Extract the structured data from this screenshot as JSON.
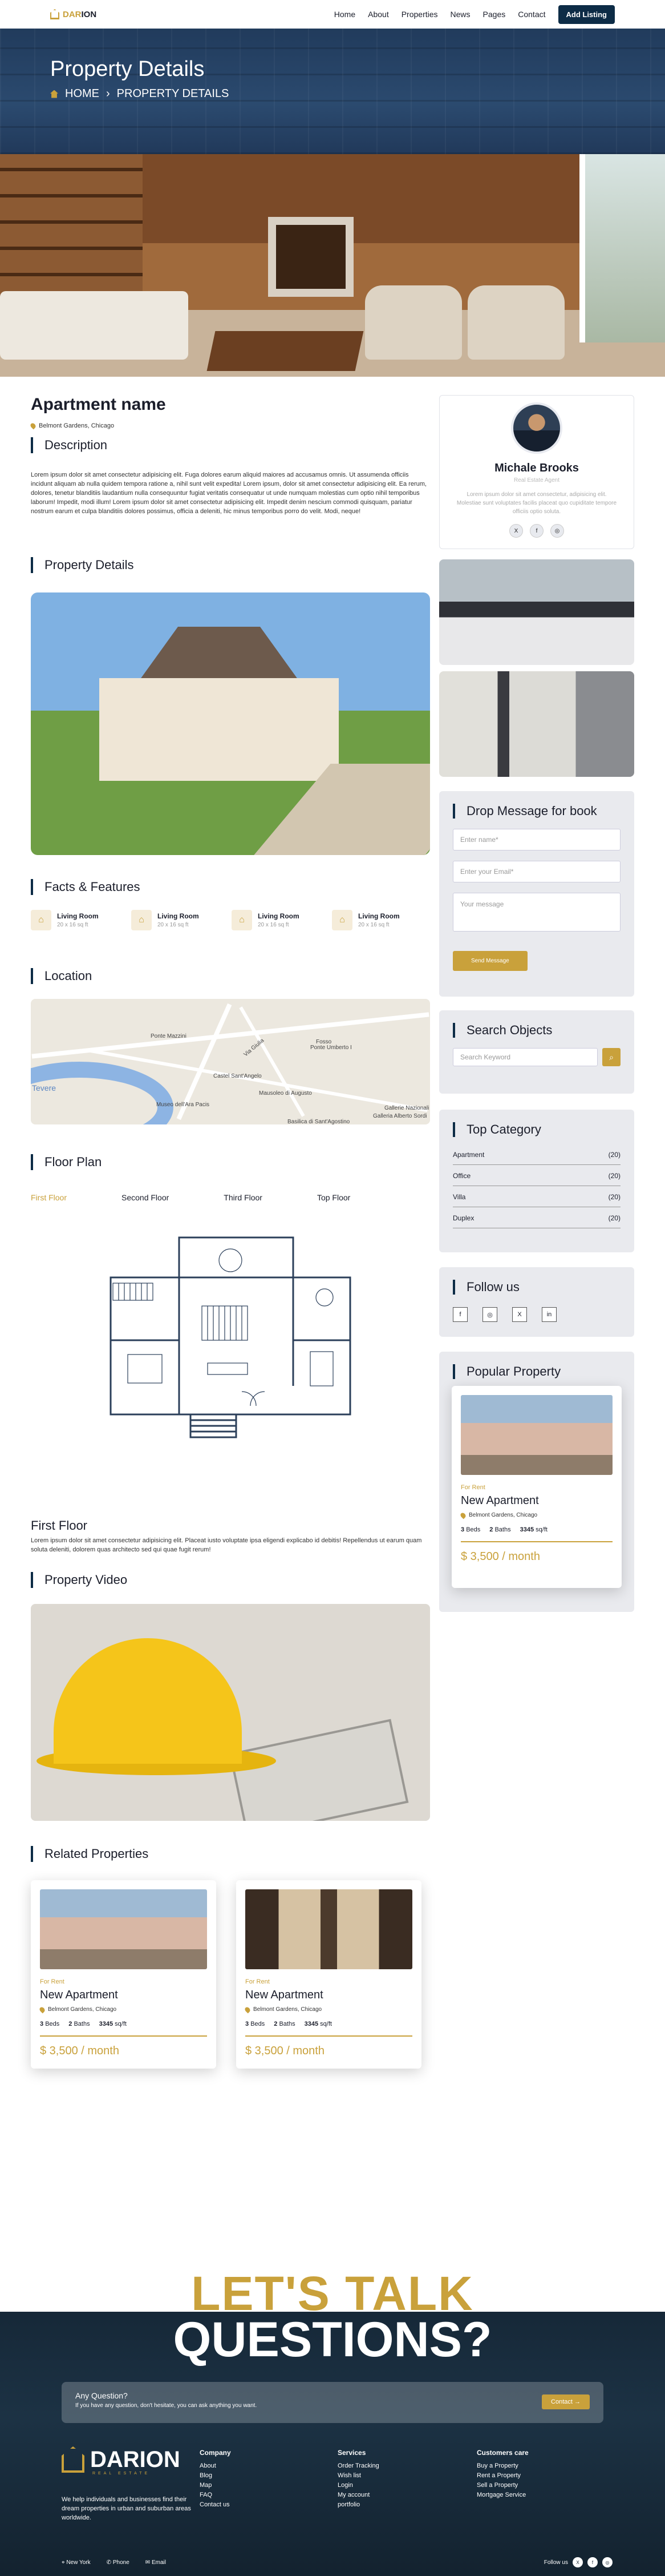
{
  "nav": {
    "brand_a": "DAR",
    "brand_b": "ION",
    "items": [
      "Home",
      "About",
      "Properties",
      "News",
      "Pages",
      "Contact"
    ],
    "cta": "Add Listing"
  },
  "hero": {
    "title": "Property Details",
    "crumb_home": "HOME",
    "crumb_sep": "›",
    "crumb_current": "PROPERTY DETAILS"
  },
  "listing": {
    "name": "Apartment name",
    "address": "Belmont Gardens, Chicago",
    "description_title": "Description",
    "description": "Lorem ipsum dolor sit amet consectetur adipisicing elit. Fuga dolores earum aliquid maiores ad accusamus omnis. Ut assumenda officiis incidunt aliquam ab nulla quidem tempora ratione a, nihil sunt velit expedita! Lorem ipsum, dolor sit amet consectetur adipisicing elit. Ea rerum, dolores, tenetur blanditiis laudantium nulla consequuntur fugiat veritatis consequatur ut unde numquam molestias cum optio nihil temporibus laborum! Impedit, modi illum! Lorem ipsum dolor sit amet consectetur adipisicing elit. Impedit denim nescium commodi quisquam, pariatur nostrum earum et culpa blanditiis dolores possimus, officia a deleniti, hic minus temporibus porro do velit. Modi, neque!",
    "details_title": "Property Details",
    "facts_title": "Facts & Features",
    "facts": [
      {
        "title": "Living Room",
        "size": "20 x 16 sq ft"
      },
      {
        "title": "Living Room",
        "size": "20 x 16 sq ft"
      },
      {
        "title": "Living Room",
        "size": "20 x 16 sq ft"
      },
      {
        "title": "Living Room",
        "size": "20 x 16 sq ft"
      }
    ],
    "location_title": "Location",
    "map_labels": [
      "Ponte Mazzini",
      "Via Giulia",
      "Fosso",
      "Castel Sant'Angelo",
      "Ponte Umberto I",
      "Tevere",
      "Museo dell'Ara Pacis",
      "Mausoleo di Augusto",
      "Basilica di Sant'Agostino",
      "Galleria Alberto Sordi",
      "Gallerie Nazionali"
    ],
    "floor_title": "Floor Plan",
    "floor_tabs": [
      "First Floor",
      "Second Floor",
      "Third Floor",
      "Top Floor"
    ],
    "floor_name": "First Floor",
    "floor_desc": "Lorem ipsum dolor sit amet consectetur adipisicing elit. Placeat iusto voluptate ipsa eligendi explicabo id debitis! Repellendus ut earum quam soluta deleniti, dolorem quas architecto sed qui quae fugit rerum!",
    "video_title": "Property Video",
    "related_title": "Related Properties"
  },
  "related": [
    {
      "tag": "For Rent",
      "name": "New Apartment",
      "loc": "Belmont Gardens, Chicago",
      "beds": "3",
      "beds_l": "Beds",
      "baths": "2",
      "baths_l": "Baths",
      "area": "3345",
      "area_l": "sq/ft",
      "price": "$ 3,500 / month"
    },
    {
      "tag": "For Rent",
      "name": "New Apartment",
      "loc": "Belmont Gardens, Chicago",
      "beds": "3",
      "beds_l": "Beds",
      "baths": "2",
      "baths_l": "Baths",
      "area": "3345",
      "area_l": "sq/ft",
      "price": "$ 3,500 / month"
    }
  ],
  "agent": {
    "name": "Michale Brooks",
    "role": "Real Estate Agent",
    "bio": "Lorem ipsum dolor sit amet consectetur, adipisicing elit. Molestiae sunt voluptates facilis placeat quo cupiditate tempore officiis optio soluta.",
    "socials": [
      "X",
      "f",
      "◎"
    ]
  },
  "message": {
    "title": "Drop Message for book",
    "name_ph": "Enter name*",
    "email_ph": "Enter your Email*",
    "msg_ph": "Your message",
    "send": "Send Message"
  },
  "search": {
    "title": "Search Objects",
    "placeholder": "Search Keyword"
  },
  "categories": {
    "title": "Top Category",
    "items": [
      {
        "name": "Apartment",
        "count": "(20)"
      },
      {
        "name": "Office",
        "count": "(20)"
      },
      {
        "name": "Villa",
        "count": "(20)"
      },
      {
        "name": "Duplex",
        "count": "(20)"
      }
    ]
  },
  "follow": {
    "title": "Follow us",
    "icons": [
      "f",
      "◎",
      "X",
      "in"
    ]
  },
  "popular": {
    "title": "Popular Property",
    "tag": "For Rent",
    "name": "New Apartment",
    "loc": "Belmont Gardens, Chicago",
    "beds": "3",
    "beds_l": "Beds",
    "baths": "2",
    "baths_l": "Baths",
    "area": "3345",
    "area_l": "sq/ft",
    "price": "$ 3,500 / month"
  },
  "footer": {
    "lets": "LET'S TALK",
    "questions": "QUESTIONS?",
    "ask_title": "Any Question?",
    "ask_sub": "If you have any question, don't hesitate, you can ask anything you want.",
    "ask_btn": "Contact →",
    "brand": "DARION",
    "brand_sub": "REAL ESTATE",
    "desc": "We help individuals and businesses find their dream properties in urban and suburban areas worldwide.",
    "company_title": "Company",
    "company": [
      "About",
      "Blog",
      "Map",
      "FAQ",
      "Contact us"
    ],
    "services_title": "Services",
    "services": [
      "Order Tracking",
      "Wish list",
      "Login",
      "My account",
      "portfolio"
    ],
    "customer_title": "Customers care",
    "customer": [
      "Buy a Property",
      "Rent a Property",
      "Sell a Property",
      "Mortgage Service"
    ],
    "bottom": [
      "New York",
      "Phone",
      "Email"
    ],
    "follow": "Follow us",
    "follow_icons": [
      "X",
      "f",
      "◎"
    ]
  }
}
